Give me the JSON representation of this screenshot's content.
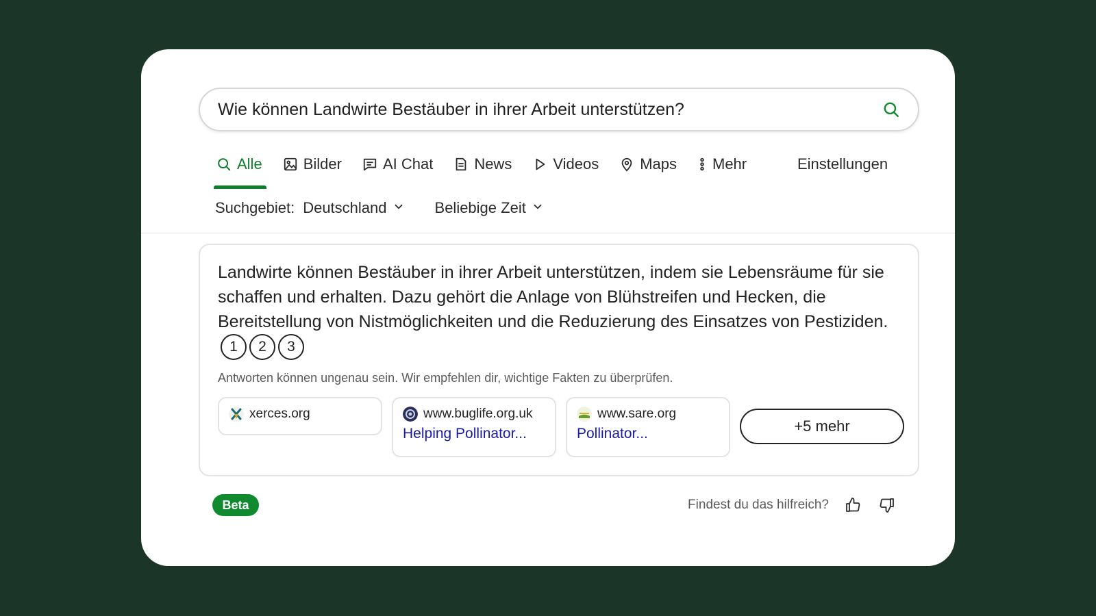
{
  "search": {
    "query": "Wie können Landwirte Bestäuber in ihrer Arbeit unterstützen?",
    "icon": "search-icon"
  },
  "tabs": [
    {
      "label": "Alle",
      "icon": "search-icon",
      "active": true
    },
    {
      "label": "Bilder",
      "icon": "image-icon"
    },
    {
      "label": "AI Chat",
      "icon": "chat-icon"
    },
    {
      "label": "News",
      "icon": "news-icon"
    },
    {
      "label": "Videos",
      "icon": "play-icon"
    },
    {
      "label": "Maps",
      "icon": "map-pin-icon"
    },
    {
      "label": "Mehr",
      "icon": "more-vertical-icon"
    }
  ],
  "settings_label": "Einstellungen",
  "filters": {
    "region_label": "Suchgebiet:",
    "region_value": "Deutschland",
    "time_value": "Beliebige Zeit"
  },
  "answer": {
    "text": "Landwirte können Bestäuber in ihrer Arbeit unterstützen, indem sie Lebensräume für sie schaffen und erhalten. Dazu gehört die Anlage von Blühstreifen und Hecken, die Bereitstellung von Nistmöglichkeiten und die Reduzierung des Einsatzes von Pestiziden.",
    "citations": [
      "1",
      "2",
      "3"
    ],
    "disclaimer": "Antworten können ungenau sein. Wir empfehlen dir, wichtige Fakten zu überprüfen."
  },
  "sources": [
    {
      "domain": "xerces.org",
      "title": ""
    },
    {
      "domain": "www.buglife.org.uk",
      "title": "Helping Pollinator..."
    },
    {
      "domain": "www.sare.org",
      "title": "Pollinator..."
    }
  ],
  "more_label": "+5 mehr",
  "beta_label": "Beta",
  "feedback": {
    "question": "Findest du das hilfreich?"
  },
  "colors": {
    "accent": "#0f7d2c",
    "background": "#1b3529",
    "link": "#1a1aa6"
  }
}
